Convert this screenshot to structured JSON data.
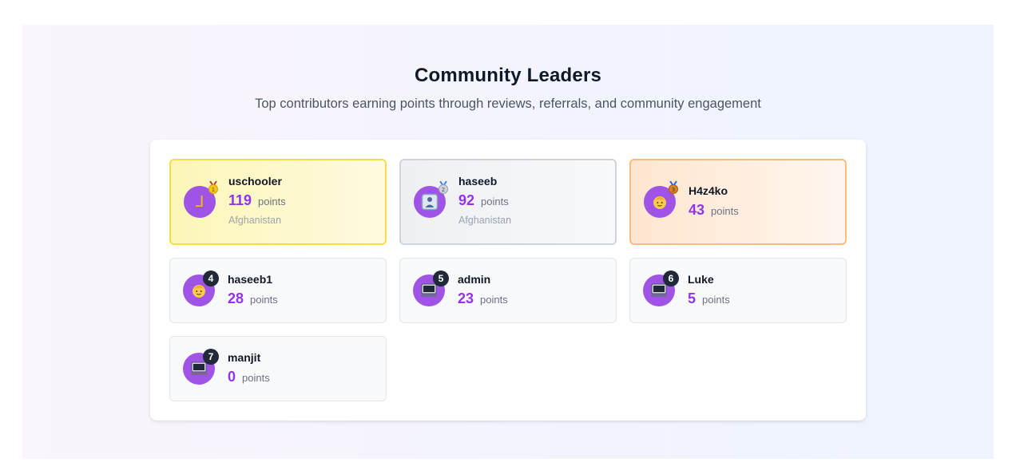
{
  "header": {
    "title": "Community Leaders",
    "subtitle": "Top contributors earning points through reviews, referrals, and community engagement"
  },
  "colors": {
    "accent": "#9333ea",
    "avatar": "#a054e6",
    "gold_border": "#f4dc4a",
    "silver_border": "#cfd3da",
    "bronze_border": "#f6be7e"
  },
  "points_label": "points",
  "leaders": [
    {
      "rank": "1",
      "name": "uschooler",
      "score": "119",
      "country": "Afghanistan",
      "avatar_icon": "L-glyph-icon",
      "medal": "gold-medal-icon"
    },
    {
      "rank": "2",
      "name": "haseeb",
      "score": "92",
      "country": "Afghanistan",
      "avatar_icon": "person-frame-icon",
      "medal": "silver-medal-icon"
    },
    {
      "rank": "3",
      "name": "H4z4ko",
      "score": "43",
      "avatar_icon": "baby-face-icon",
      "medal": "bronze-medal-icon"
    },
    {
      "rank": "4",
      "name": "haseeb1",
      "score": "28",
      "avatar_icon": "baby-face-icon"
    },
    {
      "rank": "5",
      "name": "admin",
      "score": "23",
      "avatar_icon": "computer-icon"
    },
    {
      "rank": "6",
      "name": "Luke",
      "score": "5",
      "avatar_icon": "computer-icon"
    },
    {
      "rank": "7",
      "name": "manjit",
      "score": "0",
      "avatar_icon": "computer-icon"
    }
  ]
}
